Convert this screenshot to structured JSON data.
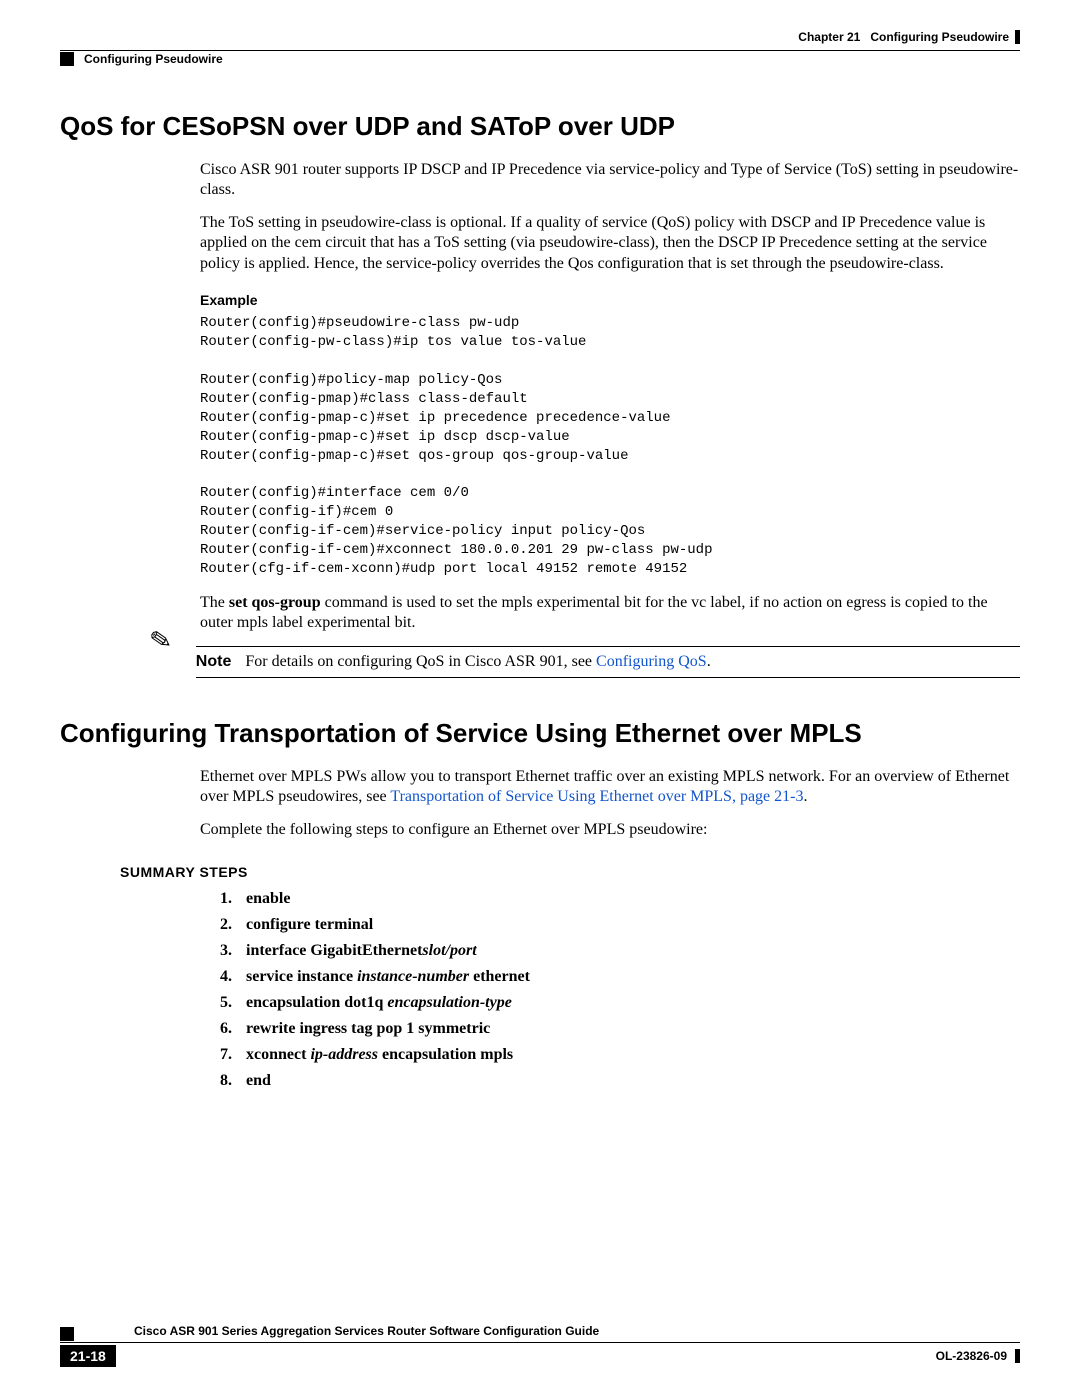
{
  "header": {
    "chapter_label": "Chapter 21",
    "chapter_title": "Configuring Pseudowire",
    "section_title": "Configuring Pseudowire"
  },
  "section1": {
    "heading": "QoS for CESoPSN over UDP and SAToP over UDP",
    "p1": "Cisco ASR 901 router supports IP DSCP and IP Precedence via service-policy and Type of Service (ToS) setting in pseudowire-class.",
    "p2": "The ToS setting in pseudowire-class is optional. If a quality of service (QoS) policy with DSCP and IP Precedence value is applied on the cem circuit that has a ToS setting (via pseudowire-class), then the DSCP IP Precedence setting at the service policy is applied. Hence, the service-policy overrides the Qos configuration that is set through the pseudowire-class.",
    "example_label": "Example",
    "code": "Router(config)#pseudowire-class pw-udp\nRouter(config-pw-class)#ip tos value tos-value\n\nRouter(config)#policy-map policy-Qos\nRouter(config-pmap)#class class-default\nRouter(config-pmap-c)#set ip precedence precedence-value\nRouter(config-pmap-c)#set ip dscp dscp-value\nRouter(config-pmap-c)#set qos-group qos-group-value\n\nRouter(config)#interface cem 0/0\nRouter(config-if)#cem 0\nRouter(config-if-cem)#service-policy input policy-Qos\nRouter(config-if-cem)#xconnect 180.0.0.201 29 pw-class pw-udp\nRouter(cfg-if-cem-xconn)#udp port local 49152 remote 49152",
    "p3_pre": "The ",
    "p3_cmd": "set  qos-group",
    "p3_post": " command is used to set the mpls experimental bit for the vc label, if no action on egress is copied to the outer mpls label experimental  bit.",
    "note_label": "Note",
    "note_text_pre": "For details on configuring QoS in Cisco ASR 901, see ",
    "note_link": "Configuring QoS",
    "note_text_post": "."
  },
  "section2": {
    "heading": "Configuring Transportation of Service Using Ethernet over MPLS",
    "p1_pre": "Ethernet over MPLS PWs allow you to transport Ethernet traffic over an existing MPLS network. For an overview of Ethernet over MPLS pseudowires, see ",
    "p1_link": "Transportation of Service Using Ethernet over MPLS, page 21-3",
    "p1_post": ".",
    "p2": "Complete the following steps to configure an Ethernet over MPLS pseudowire:",
    "summary_label": "SUMMARY STEPS",
    "steps": [
      {
        "bold": "enable"
      },
      {
        "bold": "configure terminal"
      },
      {
        "bold": "interface GigabitEthernet",
        "italic": "slot/port"
      },
      {
        "bold": "service instance ",
        "italic": "instance-number",
        "bold2": " ethernet"
      },
      {
        "bold": "encapsulation dot1q ",
        "italic": "encapsulation-type"
      },
      {
        "bold": "rewrite ingress tag pop 1 symmetric"
      },
      {
        "bold": "xconnect ",
        "italic": "ip-address",
        "bold2": " encapsulation mpls"
      },
      {
        "bold": "end"
      }
    ]
  },
  "footer": {
    "guide_title": "Cisco ASR 901 Series Aggregation Services Router Software Configuration Guide",
    "page_num": "21-18",
    "doc_id": "OL-23826-09"
  }
}
